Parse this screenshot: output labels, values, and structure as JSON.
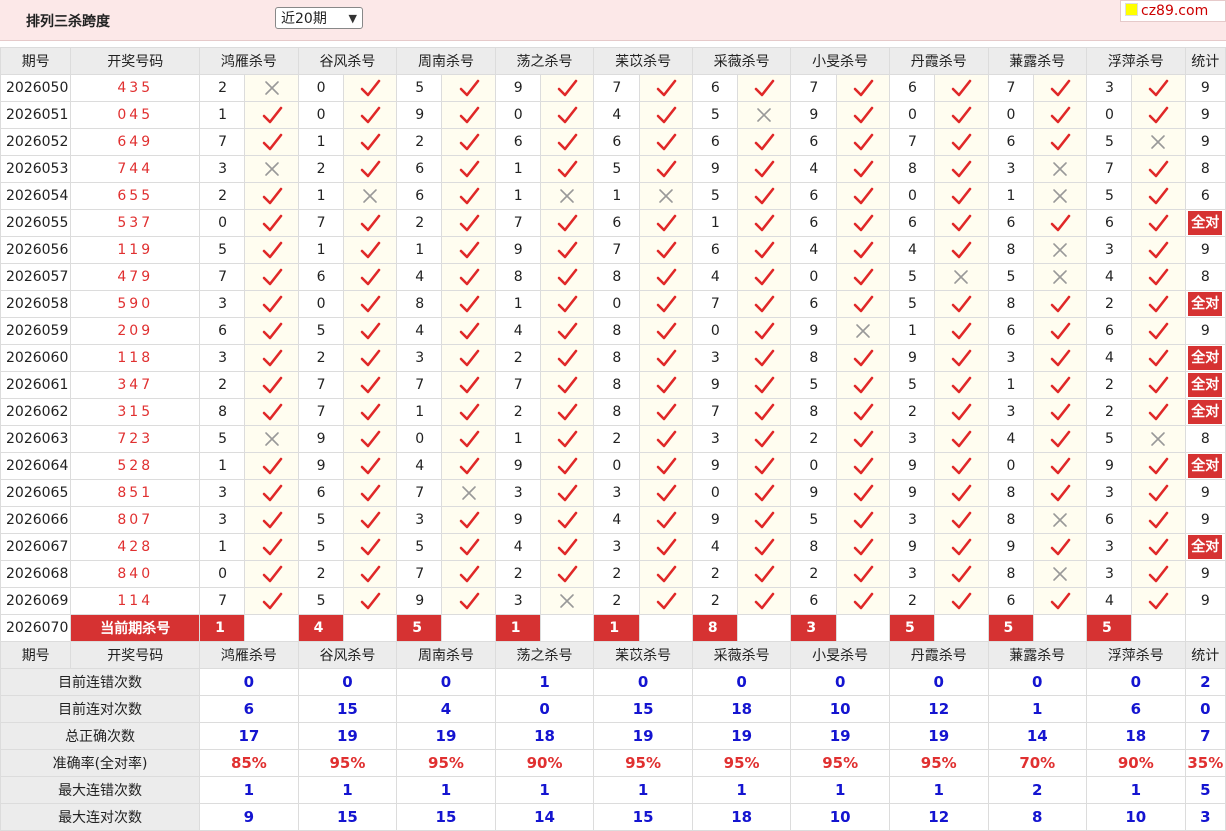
{
  "header": {
    "title": "排列三杀跨度",
    "range_select": "近20期",
    "brand": "cz89.com"
  },
  "columns": {
    "period": "期号",
    "draw": "开奖号码",
    "count": "统计",
    "experts": [
      "鸿雁杀号",
      "谷风杀号",
      "周南杀号",
      "荡之杀号",
      "苿苡杀号",
      "采薇杀号",
      "小旻杀号",
      "丹霞杀号",
      "蒹露杀号",
      "浮萍杀号"
    ]
  },
  "rows": [
    {
      "period": "2026050",
      "draw": "435",
      "nums": [
        "2",
        "0",
        "5",
        "9",
        "7",
        "6",
        "7",
        "6",
        "7",
        "3"
      ],
      "ok": [
        0,
        1,
        1,
        1,
        1,
        1,
        1,
        1,
        1,
        1
      ],
      "count": "9"
    },
    {
      "period": "2026051",
      "draw": "045",
      "nums": [
        "1",
        "0",
        "9",
        "0",
        "4",
        "5",
        "9",
        "0",
        "0",
        "0"
      ],
      "ok": [
        1,
        1,
        1,
        1,
        1,
        0,
        1,
        1,
        1,
        1
      ],
      "count": "9"
    },
    {
      "period": "2026052",
      "draw": "649",
      "nums": [
        "7",
        "1",
        "2",
        "6",
        "6",
        "6",
        "6",
        "7",
        "6",
        "5"
      ],
      "ok": [
        1,
        1,
        1,
        1,
        1,
        1,
        1,
        1,
        1,
        0
      ],
      "count": "9"
    },
    {
      "period": "2026053",
      "draw": "744",
      "nums": [
        "3",
        "2",
        "6",
        "1",
        "5",
        "9",
        "4",
        "8",
        "3",
        "7"
      ],
      "ok": [
        0,
        1,
        1,
        1,
        1,
        1,
        1,
        1,
        0,
        1
      ],
      "count": "8"
    },
    {
      "period": "2026054",
      "draw": "655",
      "nums": [
        "2",
        "1",
        "6",
        "1",
        "1",
        "5",
        "6",
        "0",
        "1",
        "5"
      ],
      "ok": [
        1,
        0,
        1,
        0,
        0,
        1,
        1,
        1,
        0,
        1
      ],
      "count": "6"
    },
    {
      "period": "2026055",
      "draw": "537",
      "nums": [
        "0",
        "7",
        "2",
        "7",
        "6",
        "1",
        "6",
        "6",
        "6",
        "6"
      ],
      "ok": [
        1,
        1,
        1,
        1,
        1,
        1,
        1,
        1,
        1,
        1
      ],
      "count": "全对"
    },
    {
      "period": "2026056",
      "draw": "119",
      "nums": [
        "5",
        "1",
        "1",
        "9",
        "7",
        "6",
        "4",
        "4",
        "8",
        "3"
      ],
      "ok": [
        1,
        1,
        1,
        1,
        1,
        1,
        1,
        1,
        0,
        1
      ],
      "count": "9"
    },
    {
      "period": "2026057",
      "draw": "479",
      "nums": [
        "7",
        "6",
        "4",
        "8",
        "8",
        "4",
        "0",
        "5",
        "5",
        "4"
      ],
      "ok": [
        1,
        1,
        1,
        1,
        1,
        1,
        1,
        0,
        0,
        1
      ],
      "count": "8"
    },
    {
      "period": "2026058",
      "draw": "590",
      "nums": [
        "3",
        "0",
        "8",
        "1",
        "0",
        "7",
        "6",
        "5",
        "8",
        "2"
      ],
      "ok": [
        1,
        1,
        1,
        1,
        1,
        1,
        1,
        1,
        1,
        1
      ],
      "count": "全对"
    },
    {
      "period": "2026059",
      "draw": "209",
      "nums": [
        "6",
        "5",
        "4",
        "4",
        "8",
        "0",
        "9",
        "1",
        "6",
        "6"
      ],
      "ok": [
        1,
        1,
        1,
        1,
        1,
        1,
        0,
        1,
        1,
        1
      ],
      "count": "9"
    },
    {
      "period": "2026060",
      "draw": "118",
      "nums": [
        "3",
        "2",
        "3",
        "2",
        "8",
        "3",
        "8",
        "9",
        "3",
        "4"
      ],
      "ok": [
        1,
        1,
        1,
        1,
        1,
        1,
        1,
        1,
        1,
        1
      ],
      "count": "全对"
    },
    {
      "period": "2026061",
      "draw": "347",
      "nums": [
        "2",
        "7",
        "7",
        "7",
        "8",
        "9",
        "5",
        "5",
        "1",
        "2"
      ],
      "ok": [
        1,
        1,
        1,
        1,
        1,
        1,
        1,
        1,
        1,
        1
      ],
      "count": "全对"
    },
    {
      "period": "2026062",
      "draw": "315",
      "nums": [
        "8",
        "7",
        "1",
        "2",
        "8",
        "7",
        "8",
        "2",
        "3",
        "2"
      ],
      "ok": [
        1,
        1,
        1,
        1,
        1,
        1,
        1,
        1,
        1,
        1
      ],
      "count": "全对"
    },
    {
      "period": "2026063",
      "draw": "723",
      "nums": [
        "5",
        "9",
        "0",
        "1",
        "2",
        "3",
        "2",
        "3",
        "4",
        "5"
      ],
      "ok": [
        0,
        1,
        1,
        1,
        1,
        1,
        1,
        1,
        1,
        0
      ],
      "count": "8"
    },
    {
      "period": "2026064",
      "draw": "528",
      "nums": [
        "1",
        "9",
        "4",
        "9",
        "0",
        "9",
        "0",
        "9",
        "0",
        "9"
      ],
      "ok": [
        1,
        1,
        1,
        1,
        1,
        1,
        1,
        1,
        1,
        1
      ],
      "count": "全对"
    },
    {
      "period": "2026065",
      "draw": "851",
      "nums": [
        "3",
        "6",
        "7",
        "3",
        "3",
        "0",
        "9",
        "9",
        "8",
        "3"
      ],
      "ok": [
        1,
        1,
        0,
        1,
        1,
        1,
        1,
        1,
        1,
        1
      ],
      "count": "9"
    },
    {
      "period": "2026066",
      "draw": "807",
      "nums": [
        "3",
        "5",
        "3",
        "9",
        "4",
        "9",
        "5",
        "3",
        "8",
        "6"
      ],
      "ok": [
        1,
        1,
        1,
        1,
        1,
        1,
        1,
        1,
        0,
        1
      ],
      "count": "9"
    },
    {
      "period": "2026067",
      "draw": "428",
      "nums": [
        "1",
        "5",
        "5",
        "4",
        "3",
        "4",
        "8",
        "9",
        "9",
        "3"
      ],
      "ok": [
        1,
        1,
        1,
        1,
        1,
        1,
        1,
        1,
        1,
        1
      ],
      "count": "全对"
    },
    {
      "period": "2026068",
      "draw": "840",
      "nums": [
        "0",
        "2",
        "7",
        "2",
        "2",
        "2",
        "2",
        "3",
        "8",
        "3"
      ],
      "ok": [
        1,
        1,
        1,
        1,
        1,
        1,
        1,
        1,
        0,
        1
      ],
      "count": "9"
    },
    {
      "period": "2026069",
      "draw": "114",
      "nums": [
        "7",
        "5",
        "9",
        "3",
        "2",
        "2",
        "6",
        "2",
        "6",
        "4"
      ],
      "ok": [
        1,
        1,
        1,
        0,
        1,
        1,
        1,
        1,
        1,
        1
      ],
      "count": "9"
    }
  ],
  "current": {
    "period": "2026070",
    "label": "当前期杀号",
    "nums": [
      "1",
      "4",
      "5",
      "1",
      "1",
      "8",
      "3",
      "5",
      "5",
      "5"
    ]
  },
  "stats": [
    {
      "label": "目前连错次数",
      "values": [
        "0",
        "0",
        "0",
        "1",
        "0",
        "0",
        "0",
        "0",
        "0",
        "0"
      ],
      "count": "2"
    },
    {
      "label": "目前连对次数",
      "values": [
        "6",
        "15",
        "4",
        "0",
        "15",
        "18",
        "10",
        "12",
        "1",
        "6"
      ],
      "count": "0"
    },
    {
      "label": "总正确次数",
      "values": [
        "17",
        "19",
        "19",
        "18",
        "19",
        "19",
        "19",
        "19",
        "14",
        "18"
      ],
      "count": "7"
    },
    {
      "label": "准确率(全对率)",
      "values": [
        "85%",
        "95%",
        "95%",
        "90%",
        "95%",
        "95%",
        "95%",
        "95%",
        "70%",
        "90%"
      ],
      "count": "35%",
      "red": true
    },
    {
      "label": "最大连错次数",
      "values": [
        "1",
        "1",
        "1",
        "1",
        "1",
        "1",
        "1",
        "1",
        "2",
        "1"
      ],
      "count": "5"
    },
    {
      "label": "最大连对次数",
      "values": [
        "9",
        "15",
        "15",
        "14",
        "15",
        "18",
        "10",
        "12",
        "8",
        "10"
      ],
      "count": "3"
    }
  ],
  "colors": {
    "header_bg": "#fce8e8",
    "accent_red": "#d63232",
    "draw_red": "#e03030",
    "stat_blue": "#1414d0",
    "check_red": "#e02828",
    "cross_gray": "#999999"
  }
}
